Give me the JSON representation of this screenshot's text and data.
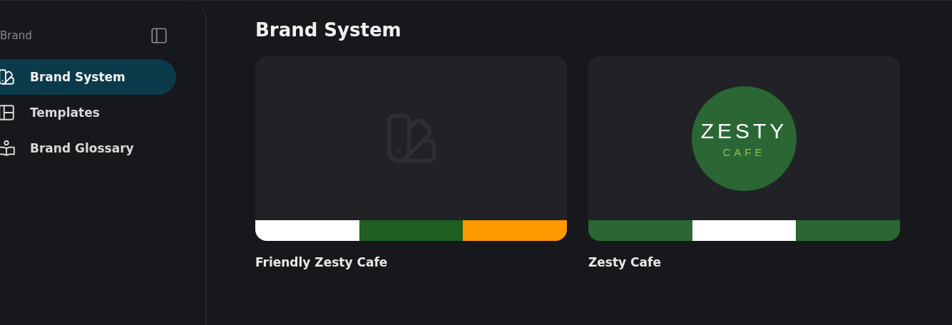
{
  "sidebar": {
    "title": "Brand",
    "items": [
      {
        "kind": "swatches",
        "label": "Brand System",
        "selected": true
      },
      {
        "kind": "layout",
        "label": "Templates",
        "selected": false
      },
      {
        "kind": "glossary",
        "label": "Brand Glossary",
        "selected": false
      }
    ]
  },
  "main": {
    "heading": "Brand System",
    "cards": [
      {
        "name": "Friendly Zesty Cafe",
        "preview": {
          "kind": "placeholder"
        },
        "swatches": [
          {
            "color": "#ffffff"
          },
          {
            "color": "#1f5f22"
          },
          {
            "color": "#ff9900"
          }
        ]
      },
      {
        "name": "Zesty Cafe",
        "preview": {
          "kind": "logo",
          "word": "ZESTY",
          "subword": "CAFE"
        },
        "swatches": [
          {
            "color": "#2a6734"
          },
          {
            "color": "#ffffff"
          },
          {
            "color": "#2a6734"
          }
        ]
      }
    ]
  }
}
